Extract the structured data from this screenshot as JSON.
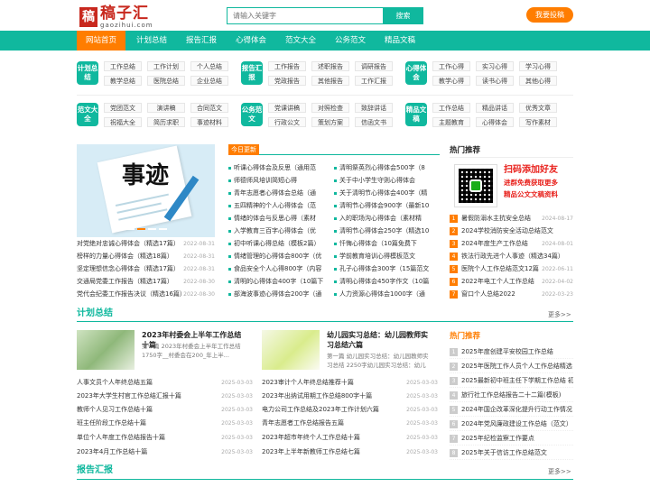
{
  "header": {
    "logo_mark": "稿",
    "logo_name": "稿子汇",
    "logo_domain": "gaozihui.com",
    "search_placeholder": "请输入关键字",
    "search_button": "搜索",
    "submit_button": "我要投稿"
  },
  "nav": {
    "items": [
      "网站首页",
      "计划总结",
      "报告汇报",
      "心得体会",
      "范文大全",
      "公务范文",
      "精品文稿"
    ]
  },
  "categories": [
    {
      "label": "计划总结",
      "items": [
        "工作总结",
        "工作计划",
        "个人总结",
        "教学总结",
        "医院总结",
        "企业总结"
      ]
    },
    {
      "label": "报告汇报",
      "items": [
        "工作报告",
        "述职报告",
        "调研报告",
        "党政报告",
        "其他报告",
        "工作汇报"
      ]
    },
    {
      "label": "心得体会",
      "items": [
        "工作心得",
        "实习心得",
        "学习心得",
        "教学心得",
        "读书心得",
        "其他心得"
      ]
    },
    {
      "label": "范文大全",
      "items": [
        "党团范文",
        "演讲稿",
        "合同范文",
        "祝福大全",
        "简历求职",
        "事迹材料"
      ]
    },
    {
      "label": "公务范文",
      "items": [
        "党课讲稿",
        "对照检查",
        "致辞讲话",
        "行政公文",
        "策划方案",
        "信函文书"
      ]
    },
    {
      "label": "精品文稿",
      "items": [
        "工作总结",
        "精品讲话",
        "优秀文章",
        "主题教育",
        "心得体会",
        "写作素材"
      ]
    }
  ],
  "banner": {
    "text": "事迹"
  },
  "left_list": [
    {
      "title": "对党绝对忠诚心得体会（精选17篇）",
      "date": "2022-08-31"
    },
    {
      "title": "榜样的力量心得体会（精选18篇）",
      "date": "2022-08-31"
    },
    {
      "title": "坚定理想信念心得体会（精选17篇）",
      "date": "2022-08-31"
    },
    {
      "title": "交通局党委工作报告（精选17篇）",
      "date": "2022-08-30"
    },
    {
      "title": "党代会纪委工作报告决议（精选16篇）",
      "date": "2022-08-30"
    }
  ],
  "today": {
    "tab": "今日更新",
    "col1": [
      "听课心得体会及反思（通用范",
      "师德师风培训简短心得",
      "青年志愿者心得体会总结（通",
      "五四精神的个人心得体会（范",
      "情绪的体会与反思心得（素材",
      "入学教育三百字心得体会（优",
      "初中听课心得总结（模板2篇）",
      "情绪管理的心得体会800字（优",
      "食品安全个人心得800字（内容",
      "清明的心得体会400字（10篇下",
      "部海波事迹心得体会200字（通"
    ],
    "col2": [
      "清明祭英烈心得体会500字（8",
      "关于中小学生守则心得体会",
      "关于清明节心得体会400字（精",
      "清明节心得体会900字（最新10",
      "入的职场沟心得体会（素材精",
      "清明节心得体会250字（精选10",
      "忏悔心得体会（10篇免费下",
      "学前教育培训心得模板范文",
      "孔子心得体会300字（15篇范文",
      "清明心得体会450字作文（10篇",
      "人力资源心得体会1000字（通"
    ]
  },
  "hot": {
    "title": "热门推荐",
    "promo_1": "扫码添加好友",
    "promo_2": "进群免费获取更多",
    "promo_3": "精品公文文稿资料",
    "items": [
      {
        "n": "1",
        "title": "暑假防溺水主抗安全总结",
        "date": "2024-08-17"
      },
      {
        "n": "2",
        "title": "2024学校消防安全活动总结范文",
        "date": ""
      },
      {
        "n": "3",
        "title": "2024年度生产工作总结",
        "date": "2024-08-01"
      },
      {
        "n": "4",
        "title": "铁法行政先进个人事迹（精选34篇）",
        "date": ""
      },
      {
        "n": "5",
        "title": "医院个人工作总结范文12篇",
        "date": "2022-06-11"
      },
      {
        "n": "6",
        "title": "2022年电工个人工作总结",
        "date": "2022-04-02"
      },
      {
        "n": "7",
        "title": "窗口个人总结2022",
        "date": "2022-03-23"
      }
    ]
  },
  "section_plan": {
    "title": "计划总结",
    "more": "更多>>",
    "feat1": {
      "title": "2023年村委会上半年工作总结十篇",
      "desc": "第一篇 2023年村委会上半年工作总结 1750字__村委会在200_年上半..."
    },
    "feat2": {
      "title": "幼儿园实习总结：幼儿园教师实习总结六篇",
      "desc": "第一篇 幼儿园实习总结：幼儿园教师实习总结 2250字幼儿园实习总结：幼儿"
    },
    "col1": [
      {
        "title": "人事文员个人年终总结五篇",
        "date": "2025-03-03"
      },
      {
        "title": "2023年大学生村官工作总结汇报十篇",
        "date": "2025-03-03"
      },
      {
        "title": "教师个人见习工作总结十篇",
        "date": "2025-03-03"
      },
      {
        "title": "班主任阶段工作总结十篇",
        "date": "2025-03-03"
      },
      {
        "title": "单位个人年度工作总结报告十篇",
        "date": "2025-03-03"
      },
      {
        "title": "2023年4月工作总结十篇",
        "date": "2025-03-03"
      }
    ],
    "col2": [
      {
        "title": "2023审计个人年终总结推荐十篇",
        "date": "2025-03-03"
      },
      {
        "title": "2023年出纳试用期工作总结800字十篇",
        "date": "2025-03-03"
      },
      {
        "title": "电力公司工作总结及2023年工作计划六篇",
        "date": "2025-03-03"
      },
      {
        "title": "青年志愿者工作总结报告五篇",
        "date": "2025-03-03"
      },
      {
        "title": "2023年超市年终个人工作总结十篇",
        "date": "2025-03-03"
      },
      {
        "title": "2023年上半年新教师工作总结七篇",
        "date": "2025-03-03"
      }
    ]
  },
  "hot2": {
    "title": "热门推荐",
    "items": [
      {
        "n": "1",
        "title": "2025年度创建平安校园工作总结"
      },
      {
        "n": "2",
        "title": "2025年医院工作人员个人工作总结精选"
      },
      {
        "n": "3",
        "title": "2025最新初中班主任下学期工作总结 初中班"
      },
      {
        "n": "4",
        "title": "旅行社工作总结报告二十二篇(模板)"
      },
      {
        "n": "5",
        "title": "2024年国企改革深化提升行动工作情况"
      },
      {
        "n": "6",
        "title": "2024年党风廉政建设工作总结（范文）"
      },
      {
        "n": "7",
        "title": "2025年纪检监察工作要点"
      },
      {
        "n": "8",
        "title": "2025年关于信访工作总结范文"
      }
    ]
  },
  "section_report": {
    "title": "报告汇报",
    "more": "更多>>"
  },
  "colors": {
    "primary": "#10b89e",
    "accent": "#ff7d00",
    "logo": "#c8281e"
  }
}
